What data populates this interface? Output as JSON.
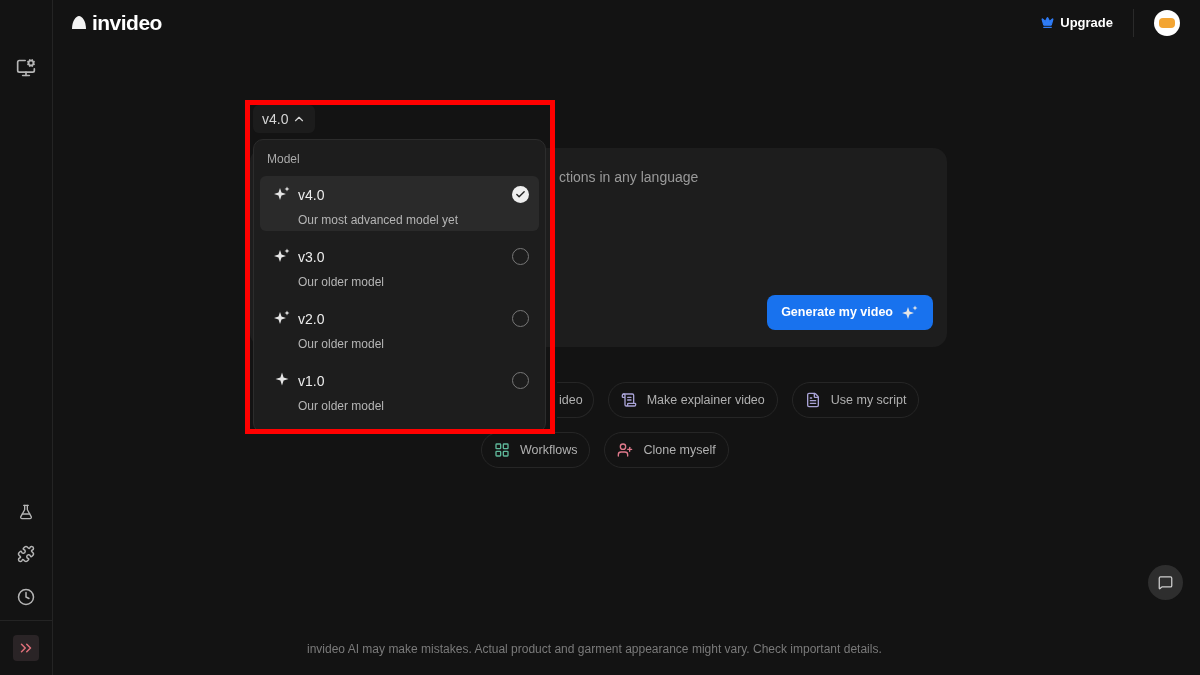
{
  "header": {
    "logo": "invideo",
    "upgrade": "Upgrade"
  },
  "model_picker": {
    "label": "v4.0",
    "expanded": true
  },
  "model_menu": {
    "heading": "Model",
    "options": [
      {
        "name": "v4.0",
        "description": "Our most advanced model yet",
        "selected": true,
        "kind": "sparkles"
      },
      {
        "name": "v3.0",
        "description": "Our older model",
        "selected": false,
        "kind": "sparkles"
      },
      {
        "name": "v2.0",
        "description": "Our older model",
        "selected": false,
        "kind": "sparkles"
      },
      {
        "name": "v1.0",
        "description": "Our older model",
        "selected": false,
        "kind": "sparkle"
      }
    ]
  },
  "prompt": {
    "placeholder": "ctions in any language",
    "button": "Generate my video"
  },
  "chips": [
    [
      {
        "label": "ideo",
        "kind": "partial"
      },
      {
        "label": "Make explainer video",
        "kind": "explainer"
      },
      {
        "label": "Use my script",
        "kind": "script"
      }
    ],
    [
      {
        "label": "Workflows",
        "kind": "workflows"
      },
      {
        "label": "Clone myself",
        "kind": "clone"
      }
    ]
  ],
  "footer": {
    "disclaimer": "invideo AI may make mistakes. Actual product and garment appearance might vary. Check important details."
  }
}
